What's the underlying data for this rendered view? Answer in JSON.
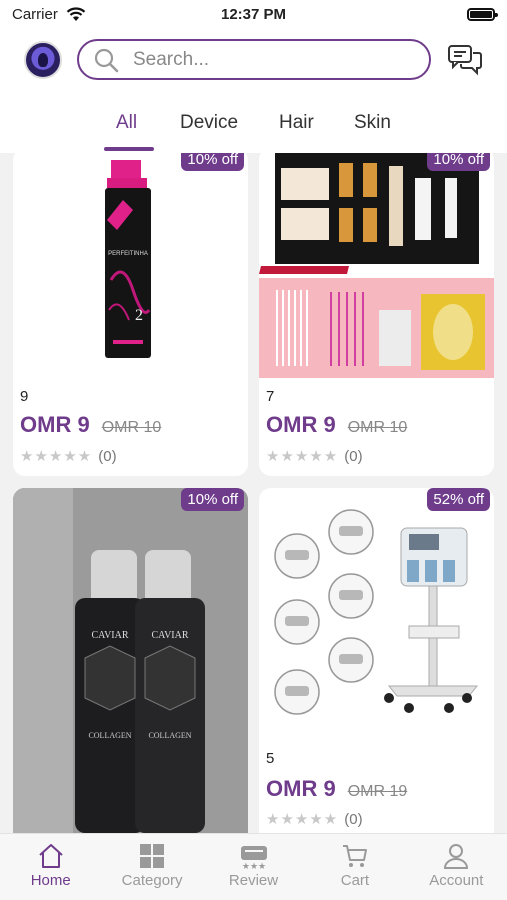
{
  "status_bar": {
    "carrier": "Carrier",
    "time": "12:37 PM"
  },
  "search": {
    "placeholder": "Search..."
  },
  "tabs": [
    {
      "label": "All",
      "active": true
    },
    {
      "label": "Device",
      "active": false
    },
    {
      "label": "Hair",
      "active": false
    },
    {
      "label": "Skin",
      "active": false
    }
  ],
  "products": [
    {
      "discount": "10% off",
      "quantity": "9",
      "price": "OMR 9",
      "old_price": "OMR 10",
      "rating_count": "(0)",
      "image": "black-pink-bottle"
    },
    {
      "discount": "10% off",
      "quantity": "7",
      "price": "OMR 9",
      "old_price": "OMR 10",
      "rating_count": "(0)",
      "image": "lash-lift-kit"
    },
    {
      "discount": "10% off",
      "image": "caviar-spray-bottles"
    },
    {
      "discount": "52% off",
      "quantity": "5",
      "price": "OMR 9",
      "old_price": "OMR 19",
      "rating_count": "(0)",
      "image": "facial-machine"
    }
  ],
  "bottom_nav": [
    {
      "label": "Home",
      "icon": "home-icon",
      "active": true
    },
    {
      "label": "Category",
      "icon": "grid-icon",
      "active": false
    },
    {
      "label": "Review",
      "icon": "review-icon",
      "active": false
    },
    {
      "label": "Cart",
      "icon": "cart-icon",
      "active": false
    },
    {
      "label": "Account",
      "icon": "user-icon",
      "active": false
    }
  ],
  "colors": {
    "accent": "#6f3c8c",
    "background": "#f1f1f2"
  }
}
